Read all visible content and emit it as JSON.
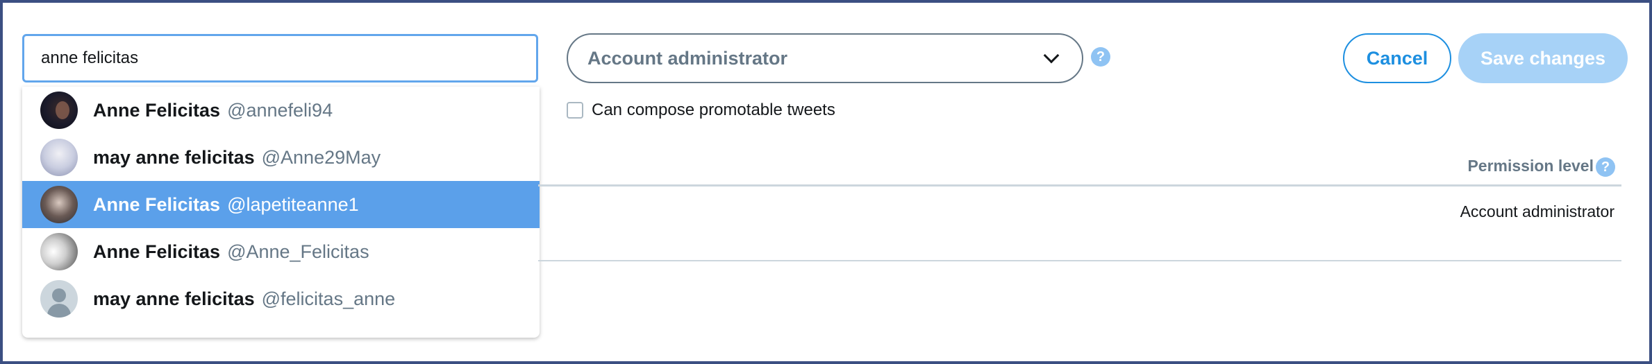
{
  "search": {
    "value": "anne felicitas"
  },
  "results": [
    {
      "name": "Anne Felicitas",
      "handle": "@annefeli94",
      "active": false
    },
    {
      "name": "may anne felicitas",
      "handle": "@Anne29May",
      "active": false
    },
    {
      "name": "Anne Felicitas",
      "handle": "@lapetiteanne1",
      "active": true
    },
    {
      "name": "Anne Felicitas",
      "handle": "@Anne_Felicitas",
      "active": false
    },
    {
      "name": "may anne felicitas",
      "handle": "@felicitas_anne",
      "active": false
    }
  ],
  "permission": {
    "selected": "Account administrator",
    "help_icon": "?"
  },
  "checkbox": {
    "label": "Can compose promotable tweets",
    "checked": false
  },
  "buttons": {
    "cancel": "Cancel",
    "save": "Save changes"
  },
  "table": {
    "header": "Permission level",
    "help_icon": "?",
    "rows": [
      {
        "permission": "Account administrator"
      }
    ]
  },
  "colors": {
    "accent": "#1d8fe0",
    "active_row": "#5ba0ea",
    "disabled_button": "#a7d2f7",
    "frame_border": "#3b4f82"
  }
}
